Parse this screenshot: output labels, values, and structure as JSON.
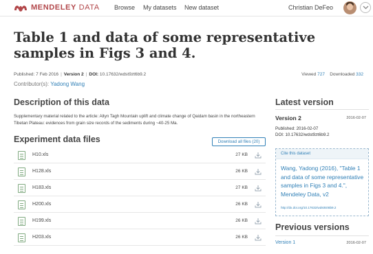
{
  "header": {
    "logo_brand": "MENDELEY",
    "logo_product": " DATA",
    "nav": [
      "Browse",
      "My datasets",
      "New dataset"
    ],
    "user_name": "Christian DeFeo",
    "brand_color": "#b2474a"
  },
  "dataset": {
    "title": "Table 1 and data of some representative samples in Figs 3 and 4.",
    "published_label": "Published: 7 Feb 2016",
    "version_label": "Version 2",
    "doi_label": "DOI:",
    "doi": "10.17632/wdst9zt6b9.2",
    "contributors_label": "Contributor(s):",
    "contributor": "Yadong Wang",
    "viewed_label": "Viewed",
    "viewed": "727",
    "downloaded_label": "Downloaded",
    "downloaded": "332"
  },
  "description": {
    "heading": "Description of this data",
    "text": "Supplementary material related to the article: Altyn Tagh Mountain uplift and climate change of Qaidam basin in the northeastern Tibetan Plateau: evidences from grain size records of the sediments during ~40-25 Ma."
  },
  "files": {
    "heading": "Experiment data files",
    "download_all": "Download all files (20)",
    "items": [
      {
        "name": "H10.xls",
        "size": "27 KB"
      },
      {
        "name": "H128.xls",
        "size": "26 KB"
      },
      {
        "name": "H183.xls",
        "size": "27 KB"
      },
      {
        "name": "H200.xls",
        "size": "26 KB"
      },
      {
        "name": "H199.xls",
        "size": "26 KB"
      },
      {
        "name": "H203.xls",
        "size": "26 KB"
      }
    ]
  },
  "latest": {
    "heading": "Latest version",
    "version": "Version 2",
    "date": "2016-02-07",
    "published": "Published: 2016-02-07",
    "doi": "DOI: 10.17632/wdst9zt6b9.2",
    "cite_label": "Cite this dataset",
    "citation": "Wang, Yadong (2016), \"Table 1 and data of some representative samples in Figs 3 and 4.\", Mendeley Data, v2",
    "citation_url": "http://dx.doi.org/10.17632/wdst9zt6b9.2"
  },
  "previous": {
    "heading": "Previous versions",
    "items": [
      {
        "version": "Version 1",
        "date": "2016-02-07"
      }
    ]
  }
}
